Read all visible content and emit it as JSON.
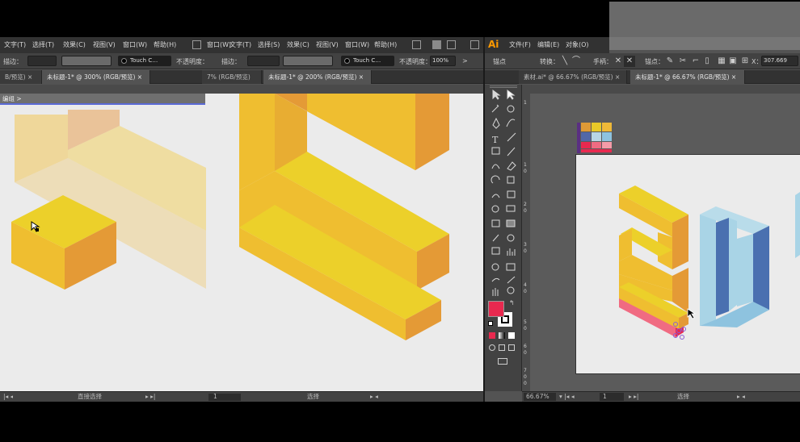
{
  "left_window": {
    "menu": [
      "选择(T)",
      "效果(C)",
      "视图(V)",
      "窗口(W)",
      "帮助(H)"
    ],
    "menu_leading": "文字(T)",
    "menu2": [
      "窗口(W)",
      "文字(T)",
      "选择(S)",
      "效果(C)",
      "视图(V)",
      "窗口(W)",
      "帮助(H)"
    ],
    "ctrl": {
      "stroke_label": "描边：",
      "brush_name": "Touch C…",
      "opacity_label": "不透明度：",
      "stroke_label2": "描边：",
      "brush_name2": "Touch C…",
      "opacity_label2": "不透明度：",
      "opacity_value": "100%"
    },
    "tabs": [
      "B/预览)",
      "未标题-1* @ 300% (RGB/预览)",
      "7% (RGB/预览)",
      "未标题-1* @ 200% (RGB/预览)"
    ],
    "breadcrumb": "编组 >",
    "status": {
      "tool_left": "直接选择",
      "page": "1",
      "tool_right": "选择"
    }
  },
  "right_window": {
    "logo": "Ai",
    "menu": [
      "文件(F)",
      "编辑(E)",
      "对象(O)"
    ],
    "ctrl": {
      "anchor_label": "锚点",
      "convert_label": "转换：",
      "handle_label": "手柄：",
      "anchor_label2": "锚点：",
      "x_value": "307.669"
    },
    "tabs": [
      "素材.ai* @ 66.67% (RGB/预览)",
      "未标题-1* @ 66.67% (RGB/预览)"
    ],
    "status": {
      "zoom": "66.67%",
      "page": "1",
      "tool": "选择"
    },
    "ruler_marks": [
      "1",
      "1",
      "0",
      "2",
      "0",
      "3",
      "0",
      "4",
      "0",
      "5",
      "0",
      "6",
      "0",
      "7",
      "0",
      "0"
    ]
  },
  "colors": {
    "fill_color": "#e8294f",
    "stroke_color": "#ffffff",
    "yellow_top": "#ecd02a",
    "yellow_left": "#efbe30",
    "yellow_right": "#e49a36",
    "blue_front": "#a9d4e6",
    "blue_side": "#4a70b0",
    "pink": "#e8294f",
    "swatches": [
      "#de9a36",
      "#e8c928",
      "#efb938",
      "#5268a8",
      "#b8d6e4",
      "#8ec3df",
      "#e8294f",
      "#f06b82",
      "#f59ba8"
    ]
  }
}
